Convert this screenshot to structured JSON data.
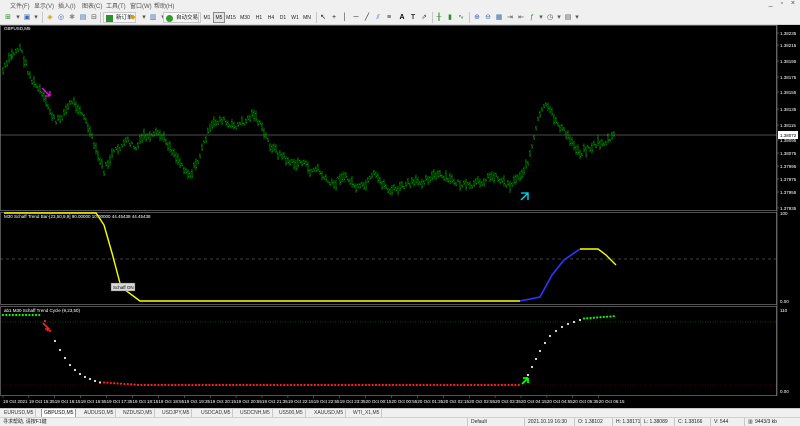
{
  "menu": {
    "items": [
      "文件(F)",
      "显示(V)",
      "插入(I)",
      "图表(C)",
      "工具(T)",
      "窗口(W)",
      "帮助(H)"
    ],
    "window_buttons": "_ ▫ ×"
  },
  "toolbar": {
    "new_order": "新订单",
    "auto_trading": "自动交易",
    "timeframes": [
      "M1",
      "M5",
      "M15",
      "M30",
      "H1",
      "H4",
      "D1",
      "W1",
      "MN"
    ],
    "active_timeframe": "M5"
  },
  "chart": {
    "symbol_label": "GBPUSD,M5",
    "price_labels": [
      "1.38235",
      "1.38215",
      "1.38195",
      "1.38175",
      "1.38155",
      "1.38135",
      "1.38115",
      "1.38095",
      "1.38075",
      "1.37995",
      "1.37975",
      "1.37955",
      "1.37935"
    ],
    "current_price": "1.38072",
    "indicator1_label": "M30 Schaff Trend Bar-[23,50,9,9] 90.00000 10.00000 44.45438 44.45438",
    "indicator1_ticks": [
      "100",
      "0.00"
    ],
    "indicator2_label": "ab1 M30 Schaff Trend Cycle (9,23,50)",
    "indicator2_ticks": [
      "110",
      "0.00"
    ],
    "tooltip": "Schaff ON",
    "time_labels": [
      "19 Oct 2021",
      "19 Oct 15:35",
      "19 Oct 16:15",
      "19 Oct 16:55",
      "19 Oct 17:35",
      "19 Oct 18:15",
      "19 Oct 18:55",
      "19 Oct 19:35",
      "19 Oct 20:15",
      "19 Oct 20:55",
      "19 Oct 21:35",
      "19 Oct 22:15",
      "19 Oct 22:55",
      "19 Oct 23:35",
      "20 Oct 00:15",
      "20 Oct 00:55",
      "20 Oct 01:35",
      "20 Oct 02:15",
      "20 Oct 02:55",
      "20 Oct 03:35",
      "20 Oct 04:15",
      "20 Oct 04:55",
      "20 Oct 05:35",
      "20 Oct 06:15"
    ]
  },
  "tabs": [
    "EURUSD,M5",
    "GBPUSD,M5",
    "AUDUSD,M5",
    "NZDUSD,M5",
    "USDJPY,M5",
    "USDCAD,M5",
    "USDCNH,M5",
    "US500,M5",
    "XAUUSD,M5",
    "WTI_X1,M5"
  ],
  "active_tab": "GBPUSD,M5",
  "status": {
    "help": "寻求帮助, 请按F1键",
    "profile": "Default",
    "datetime": "2021.10.19 16:30",
    "open": "O: 1.38102",
    "high": "H: 1.38171",
    "low": "L: 1.38089",
    "close": "C: 1.38166",
    "volume": "V: 544",
    "traffic": "9443/3 kb"
  },
  "colors": {
    "background": "#000000",
    "bars": "#00b000",
    "stc_line": "#ffff00",
    "stc_line_up": "#3333ff",
    "dots_up": "#00ff00",
    "dots_down": "#ff2020",
    "dots_neutral": "#e8e8e8"
  }
}
